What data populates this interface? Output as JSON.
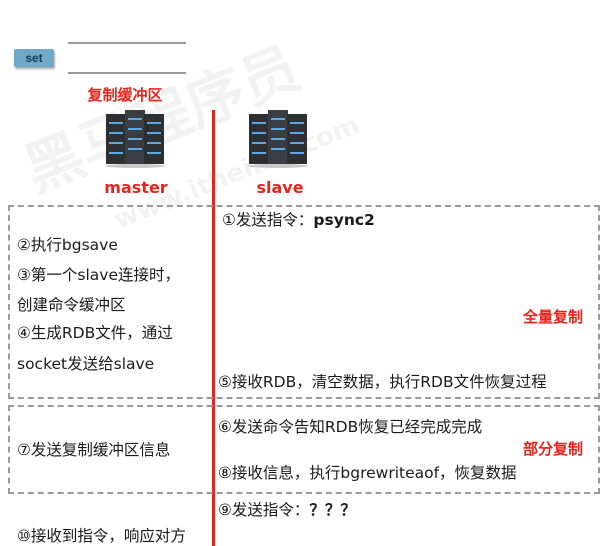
{
  "set_label": "set",
  "buffer_label": "复制缓冲区",
  "master_label": "master",
  "slave_label": "slave",
  "watermark": "黑马程序员",
  "watermark_url": "www.itheima.com",
  "full_sync": {
    "label": "全量复制",
    "slave_step1": "①发送指令：",
    "slave_step1_cmd": "psync2",
    "master_steps": [
      "②执行bgsave",
      "③第一个slave连接时，",
      "创建命令缓冲区",
      "④生成RDB文件，通过",
      "socket发送给slave"
    ],
    "slave_step5": "⑤接收RDB，清空数据，执行RDB文件恢复过程"
  },
  "partial_sync": {
    "label": "部分复制",
    "slave_step6": "⑥发送命令告知RDB恢复已经完成完成",
    "master_step7": "⑦发送复制缓冲区信息",
    "slave_step8": "⑧接收信息，执行bgrewriteaof，恢复数据"
  },
  "heartbeat": {
    "slave_step9": "⑨发送指令：",
    "slave_step9_cmd": "？？？",
    "master_step10": "⑩接收到指令，响应对方"
  },
  "colors": {
    "accent_red": "#e8241c",
    "dash_gray": "#9a9a9a",
    "set_badge": "#6fa8c8"
  }
}
